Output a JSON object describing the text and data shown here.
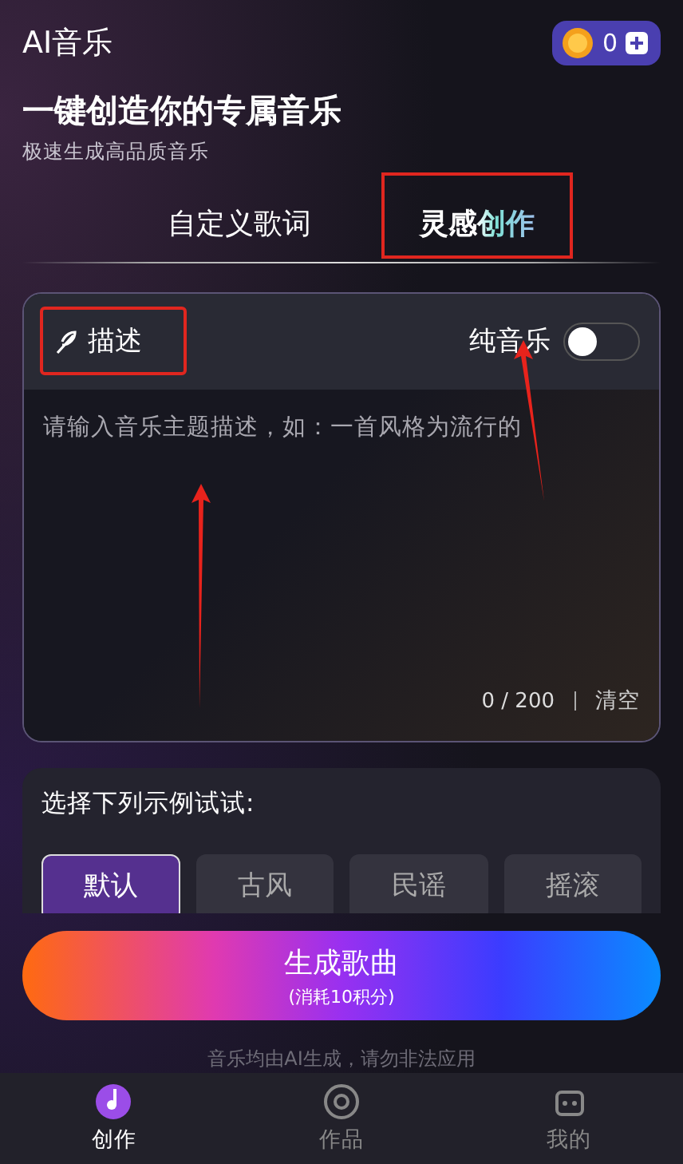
{
  "header": {
    "title": "AI音乐",
    "coins": "0",
    "headline": "一键创造你的专属音乐",
    "subtitle": "极速生成高品质音乐"
  },
  "tabs": [
    {
      "label": "自定义歌词",
      "selected": false,
      "highlighted": false
    },
    {
      "label": "灵感创作",
      "selected": true,
      "highlighted": true
    }
  ],
  "description": {
    "label": "描述",
    "highlighted": true,
    "toggle_label": "纯音乐",
    "toggle_on": false,
    "toggle_pointed": true,
    "placeholder": "请输入音乐主题描述，如：一首风格为流行的",
    "input_pointed": true,
    "counter": "0 / 200",
    "clear": "清空"
  },
  "examples": {
    "title": "选择下列示例试试:",
    "chips": [
      {
        "label": "默认",
        "selected": true
      },
      {
        "label": "古风",
        "selected": false
      },
      {
        "label": "民谣",
        "selected": false
      },
      {
        "label": "摇滚",
        "selected": false
      }
    ]
  },
  "generate": {
    "label": "生成歌曲",
    "note": "(消耗10积分)"
  },
  "disclaimer": "音乐均由AI生成，请勿非法应用",
  "nav": [
    {
      "label": "创作",
      "selected": true,
      "kind": "create"
    },
    {
      "label": "作品",
      "selected": false,
      "kind": "works"
    },
    {
      "label": "我的",
      "selected": false,
      "kind": "me"
    }
  ]
}
